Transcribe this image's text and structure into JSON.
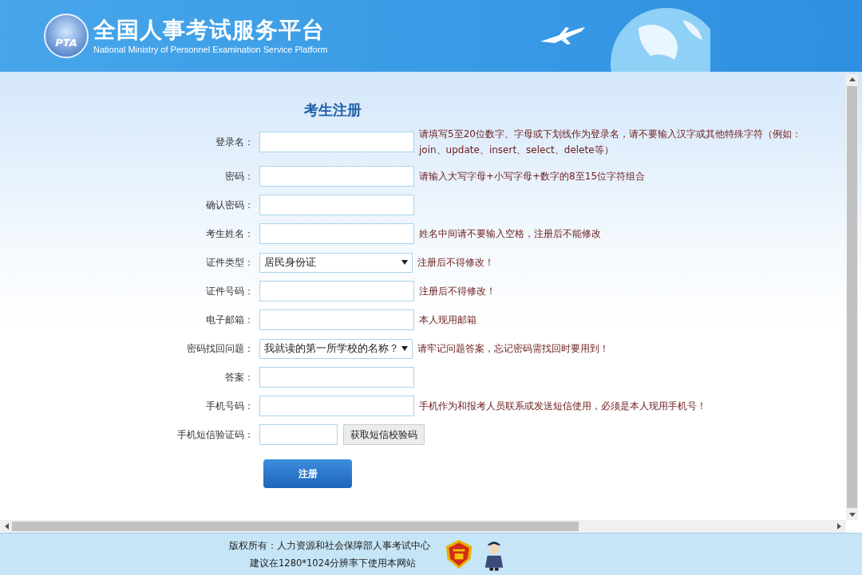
{
  "header": {
    "logo_text": "PTA",
    "title": "全国人事考试服务平台",
    "subtitle": "National Ministry of Personnel Examination Service Platform"
  },
  "form": {
    "title": "考生注册",
    "fields": [
      {
        "kind": "input",
        "label": "登录名：",
        "hint": "请填写5至20位数字、字母或下划线作为登录名，请不要输入汉字或其他特殊字符（例如：join、update、insert、select、delete等）"
      },
      {
        "kind": "input",
        "label": "密码：",
        "hint": "请输入大写字母+小写字母+数字的8至15位字符组合"
      },
      {
        "kind": "input",
        "label": "确认密码："
      },
      {
        "kind": "input",
        "label": "考生姓名：",
        "hint": "姓名中间请不要输入空格，注册后不能修改"
      },
      {
        "kind": "select",
        "label": "证件类型：",
        "value": "居民身份证",
        "hint": "注册后不得修改！"
      },
      {
        "kind": "input",
        "label": "证件号码：",
        "hint": "注册后不得修改！"
      },
      {
        "kind": "input",
        "label": "电子邮箱：",
        "hint": "本人现用邮箱"
      },
      {
        "kind": "select",
        "label": "密码找回问题：",
        "value": "我就读的第一所学校的名称？",
        "hint": "请牢记问题答案，忘记密码需找回时要用到！"
      },
      {
        "kind": "input",
        "label": "答案："
      },
      {
        "kind": "input",
        "label": "手机号码：",
        "hint": "手机作为和报考人员联系或发送短信使用，必须是本人现用手机号！"
      },
      {
        "kind": "sms",
        "label": "手机短信验证码：",
        "button": "获取短信校验码"
      }
    ],
    "submit": "注册"
  },
  "footer": {
    "copyright": "版权所有：人力资源和社会保障部人事考试中心",
    "note": "建议在1280*1024分辨率下使用本网站"
  }
}
